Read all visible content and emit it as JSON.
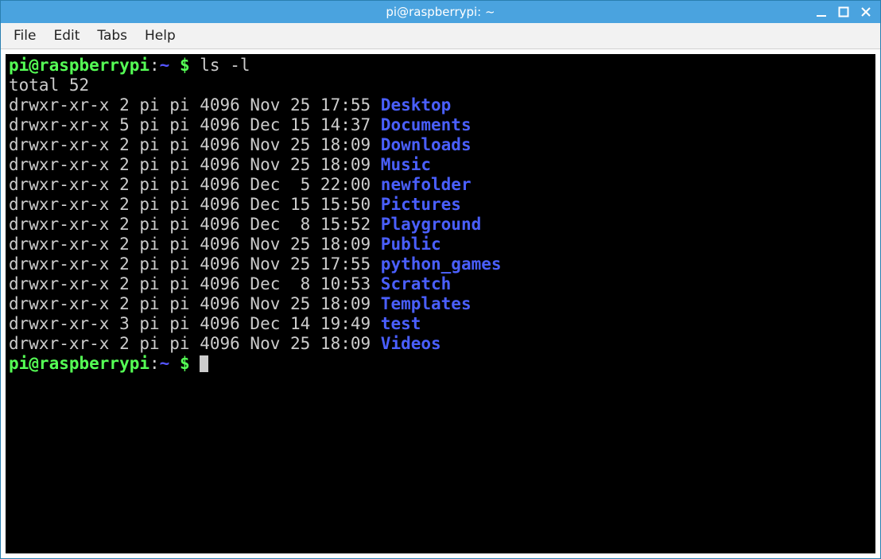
{
  "window": {
    "title": "pi@raspberrypi: ~"
  },
  "menu": {
    "file": "File",
    "edit": "Edit",
    "tabs": "Tabs",
    "help": "Help"
  },
  "prompt": {
    "userhost": "pi@raspberrypi",
    "colon": ":",
    "path": "~",
    "dollar": " $ "
  },
  "command": "ls -l",
  "total_line": "total 52",
  "listing": [
    {
      "perm": "drwxr-xr-x",
      "links": "2",
      "owner": "pi",
      "group": "pi",
      "size": "4096",
      "month": "Nov",
      "day": "25",
      "time": "17:55",
      "name": "Desktop"
    },
    {
      "perm": "drwxr-xr-x",
      "links": "5",
      "owner": "pi",
      "group": "pi",
      "size": "4096",
      "month": "Dec",
      "day": "15",
      "time": "14:37",
      "name": "Documents"
    },
    {
      "perm": "drwxr-xr-x",
      "links": "2",
      "owner": "pi",
      "group": "pi",
      "size": "4096",
      "month": "Nov",
      "day": "25",
      "time": "18:09",
      "name": "Downloads"
    },
    {
      "perm": "drwxr-xr-x",
      "links": "2",
      "owner": "pi",
      "group": "pi",
      "size": "4096",
      "month": "Nov",
      "day": "25",
      "time": "18:09",
      "name": "Music"
    },
    {
      "perm": "drwxr-xr-x",
      "links": "2",
      "owner": "pi",
      "group": "pi",
      "size": "4096",
      "month": "Dec",
      "day": " 5",
      "time": "22:00",
      "name": "newfolder"
    },
    {
      "perm": "drwxr-xr-x",
      "links": "2",
      "owner": "pi",
      "group": "pi",
      "size": "4096",
      "month": "Dec",
      "day": "15",
      "time": "15:50",
      "name": "Pictures"
    },
    {
      "perm": "drwxr-xr-x",
      "links": "2",
      "owner": "pi",
      "group": "pi",
      "size": "4096",
      "month": "Dec",
      "day": " 8",
      "time": "15:52",
      "name": "Playground"
    },
    {
      "perm": "drwxr-xr-x",
      "links": "2",
      "owner": "pi",
      "group": "pi",
      "size": "4096",
      "month": "Nov",
      "day": "25",
      "time": "18:09",
      "name": "Public"
    },
    {
      "perm": "drwxr-xr-x",
      "links": "2",
      "owner": "pi",
      "group": "pi",
      "size": "4096",
      "month": "Nov",
      "day": "25",
      "time": "17:55",
      "name": "python_games"
    },
    {
      "perm": "drwxr-xr-x",
      "links": "2",
      "owner": "pi",
      "group": "pi",
      "size": "4096",
      "month": "Dec",
      "day": " 8",
      "time": "10:53",
      "name": "Scratch"
    },
    {
      "perm": "drwxr-xr-x",
      "links": "2",
      "owner": "pi",
      "group": "pi",
      "size": "4096",
      "month": "Nov",
      "day": "25",
      "time": "18:09",
      "name": "Templates"
    },
    {
      "perm": "drwxr-xr-x",
      "links": "3",
      "owner": "pi",
      "group": "pi",
      "size": "4096",
      "month": "Dec",
      "day": "14",
      "time": "19:49",
      "name": "test"
    },
    {
      "perm": "drwxr-xr-x",
      "links": "2",
      "owner": "pi",
      "group": "pi",
      "size": "4096",
      "month": "Nov",
      "day": "25",
      "time": "18:09",
      "name": "Videos"
    }
  ]
}
